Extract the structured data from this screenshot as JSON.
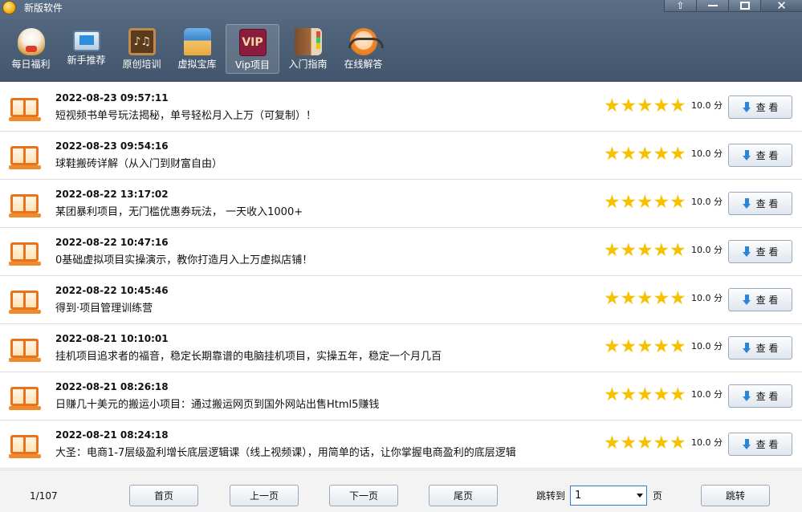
{
  "window": {
    "title": "新版软件",
    "controls": [
      "skin-icon",
      "minimize-icon",
      "maximize-icon",
      "close-icon"
    ]
  },
  "toolbar": {
    "items": [
      {
        "label": "每日福利",
        "icon": "lucky-cat-icon",
        "active": false
      },
      {
        "label": "新手推荐",
        "icon": "computer-icon",
        "active": false
      },
      {
        "label": "原创培训",
        "icon": "chalkboard-icon",
        "active": false
      },
      {
        "label": "虚拟宝库",
        "icon": "store-icon",
        "active": false
      },
      {
        "label": "Vip项目",
        "icon": "vip-icon",
        "icon_text": "VIP",
        "active": true
      },
      {
        "label": "入门指南",
        "icon": "guide-book-icon",
        "active": false
      },
      {
        "label": "在线解答",
        "icon": "support-agent-icon",
        "active": false
      }
    ]
  },
  "list": {
    "view_label": "查 看",
    "score_unit": "分",
    "star_color": "#f6c200",
    "items": [
      {
        "date": "2022-08-23 09:57:11",
        "title": "短视频书单号玩法揭秘，单号轻松月入上万（可复制）！",
        "stars": 5,
        "score": "10.0"
      },
      {
        "date": "2022-08-23 09:54:16",
        "title": "球鞋搬砖详解（从入门到财富自由）",
        "stars": 5,
        "score": "10.0"
      },
      {
        "date": "2022-08-22 13:17:02",
        "title": "某团暴利项目，无门槛优惠券玩法， 一天收入1000+",
        "stars": 5,
        "score": "10.0"
      },
      {
        "date": "2022-08-22 10:47:16",
        "title": "0基础虚拟项目实操演示，教你打造月入上万虚拟店铺！",
        "stars": 5,
        "score": "10.0"
      },
      {
        "date": "2022-08-22 10:45:46",
        "title": "得到·项目管理训练营",
        "stars": 5,
        "score": "10.0"
      },
      {
        "date": "2022-08-21 10:10:01",
        "title": "挂机项目追求者的福音，稳定长期靠谱的电脑挂机项目，实操五年，稳定一个月几百",
        "stars": 5,
        "score": "10.0"
      },
      {
        "date": "2022-08-21 08:26:18",
        "title": "日赚几十美元的搬运小项目：通过搬运网页到国外网站出售Html5赚钱",
        "stars": 5,
        "score": "10.0"
      },
      {
        "date": "2022-08-21 08:24:18",
        "title": "大圣：电商1-7层级盈利增长底层逻辑课（线上视频课），用简单的话，让你掌握电商盈利的底层逻辑",
        "stars": 5,
        "score": "10.0"
      }
    ]
  },
  "pagination": {
    "page_count": "1/107",
    "first": "首页",
    "prev": "上一页",
    "next": "下一页",
    "last": "尾页",
    "jump_label": "跳转到",
    "jump_value": "1",
    "page_unit": "页",
    "jump_button": "跳转"
  }
}
